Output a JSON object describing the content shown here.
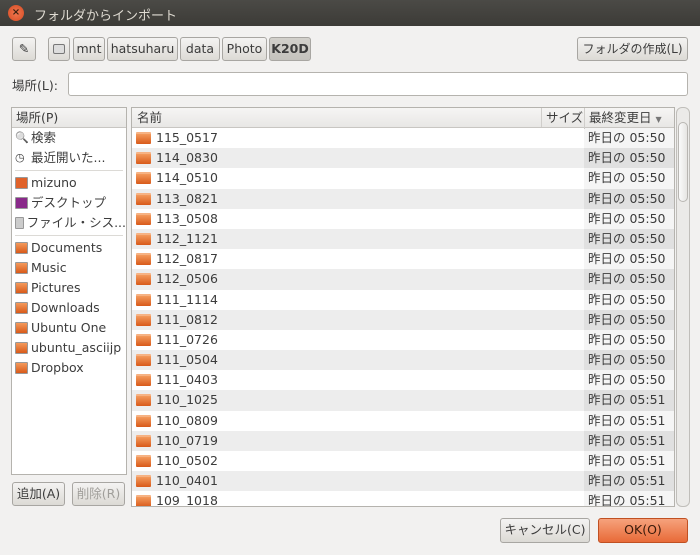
{
  "window": {
    "title": "フォルダからインポート"
  },
  "toolbar": {
    "path": [
      "mnt",
      "hatsuharu",
      "data",
      "Photo",
      "K20D"
    ],
    "create_folder": "フォルダの作成(L)"
  },
  "location": {
    "label": "場所(L):",
    "value": ""
  },
  "sidebar": {
    "header": "場所(P)",
    "groups": [
      [
        {
          "label": "検索",
          "icon": "search-icon"
        },
        {
          "label": "最近開いた...",
          "icon": "clock-icon"
        }
      ],
      [
        {
          "label": "mizuno",
          "icon": "home-icon"
        },
        {
          "label": "デスクトップ",
          "icon": "desktop-icon"
        },
        {
          "label": "ファイル・シス...",
          "icon": "drive-icon"
        }
      ],
      [
        {
          "label": "Documents",
          "icon": "documents-folder-icon"
        },
        {
          "label": "Music",
          "icon": "music-folder-icon"
        },
        {
          "label": "Pictures",
          "icon": "pictures-folder-icon"
        },
        {
          "label": "Downloads",
          "icon": "downloads-folder-icon"
        },
        {
          "label": "Ubuntu One",
          "icon": "folder-icon"
        },
        {
          "label": "ubuntu_asciijp",
          "icon": "folder-icon"
        },
        {
          "label": "Dropbox",
          "icon": "folder-icon"
        }
      ]
    ],
    "add": "追加(A)",
    "remove": "削除(R)"
  },
  "files": {
    "columns": {
      "name": "名前",
      "size": "サイズ",
      "modified": "最終変更日"
    },
    "rows": [
      {
        "name": "115_0517",
        "modified": "昨日の 05:50"
      },
      {
        "name": "114_0830",
        "modified": "昨日の 05:50"
      },
      {
        "name": "114_0510",
        "modified": "昨日の 05:50"
      },
      {
        "name": "113_0821",
        "modified": "昨日の 05:50"
      },
      {
        "name": "113_0508",
        "modified": "昨日の 05:50"
      },
      {
        "name": "112_1121",
        "modified": "昨日の 05:50"
      },
      {
        "name": "112_0817",
        "modified": "昨日の 05:50"
      },
      {
        "name": "112_0506",
        "modified": "昨日の 05:50"
      },
      {
        "name": "111_1114",
        "modified": "昨日の 05:50"
      },
      {
        "name": "111_0812",
        "modified": "昨日の 05:50"
      },
      {
        "name": "111_0726",
        "modified": "昨日の 05:50"
      },
      {
        "name": "111_0504",
        "modified": "昨日の 05:50"
      },
      {
        "name": "111_0403",
        "modified": "昨日の 05:50"
      },
      {
        "name": "110_1025",
        "modified": "昨日の 05:51"
      },
      {
        "name": "110_0809",
        "modified": "昨日の 05:51"
      },
      {
        "name": "110_0719",
        "modified": "昨日の 05:51"
      },
      {
        "name": "110_0502",
        "modified": "昨日の 05:51"
      },
      {
        "name": "110_0401",
        "modified": "昨日の 05:51"
      },
      {
        "name": "109_1018",
        "modified": "昨日の 05:51"
      }
    ]
  },
  "buttons": {
    "cancel": "キャンセル(C)",
    "ok": "OK(O)"
  },
  "colors": {
    "accent": "#e95420",
    "titlebar": "#3c3b37"
  }
}
